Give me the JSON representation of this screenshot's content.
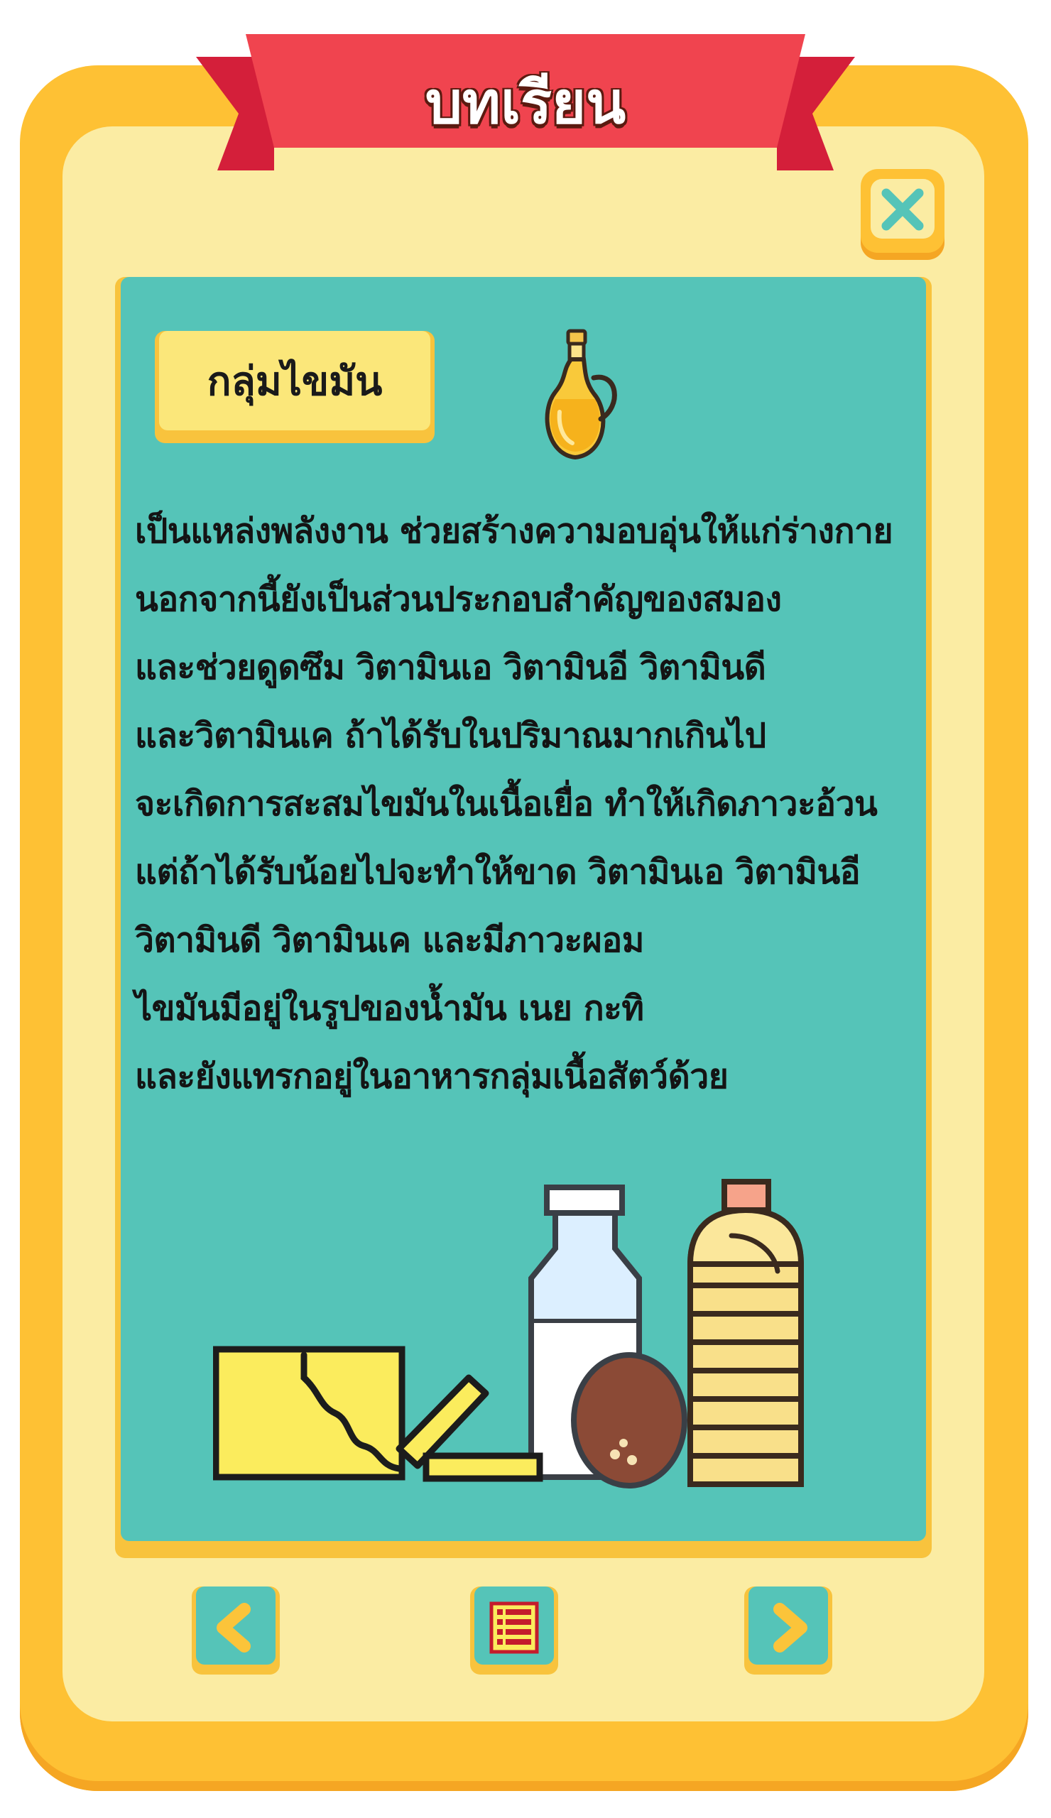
{
  "header": {
    "title": "บทเรียน"
  },
  "lesson": {
    "category": "กลุ่มไขมัน",
    "lines": [
      "เป็นแหล่งพลังงาน ช่วยสร้างความอบอุ่นให้แก่ร่างกาย",
      "นอกจากนี้ยังเป็นส่วนประกอบสำคัญของสมอง",
      "และช่วยดูดซึม วิตามินเอ วิตามินอี วิตามินดี",
      "และวิตามินเค ถ้าได้รับในปริมาณมากเกินไป",
      "จะเกิดการสะสมไขมันในเนื้อเยื่อ ทำให้เกิดภาวะอ้วน",
      "แต่ถ้าได้รับน้อยไปจะทำให้ขาด วิตามินเอ วิตามินอี",
      "วิตามินดี วิตามินเค และมีภาวะผอม",
      "ไขมันมีอยู่ในรูปของน้ำมัน เนย กะทิ",
      "และยังแทรกอยู่ในอาหารกลุ่มเนื้อสัตว์ด้วย"
    ]
  },
  "icons": {
    "close": "close-icon",
    "oil": "oil-jug-icon",
    "foods": "fat-foods-illustration",
    "prev": "chevron-left-icon",
    "menu": "menu-list-icon",
    "next": "chevron-right-icon"
  },
  "colors": {
    "frame": "#fec134",
    "frame_inner": "#fbeca3",
    "ribbon": "#f0444f",
    "panel": "#55c4b8",
    "label": "#fbe77a"
  }
}
